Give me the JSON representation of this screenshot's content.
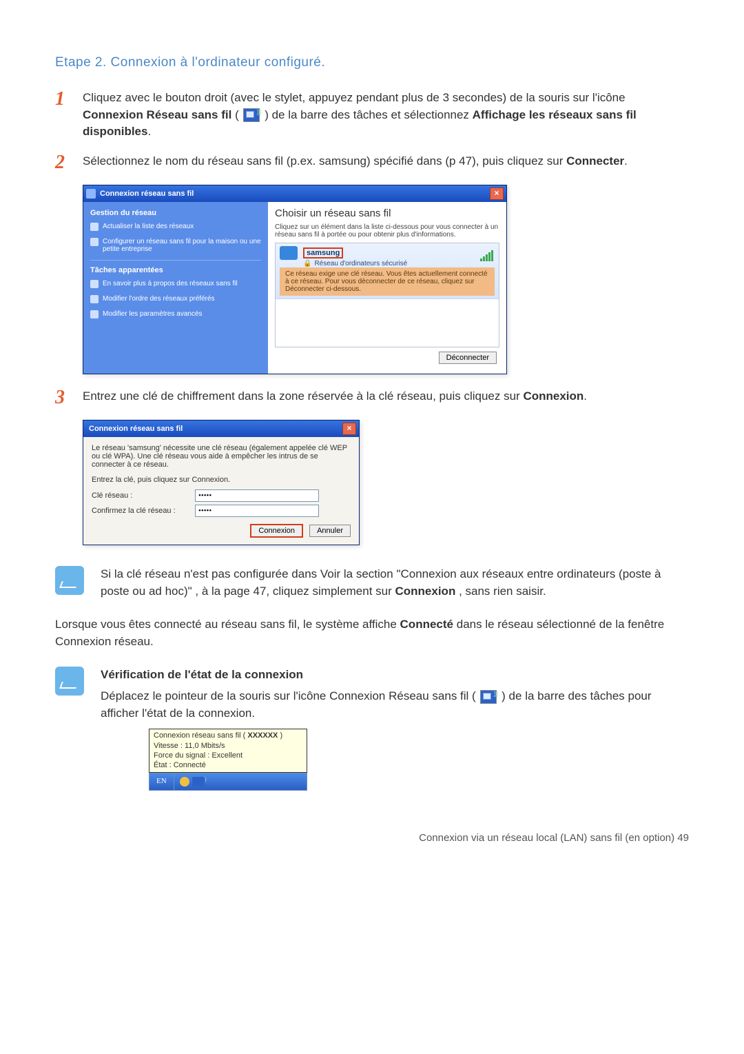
{
  "section_title": "Etape 2. Connexion à l'ordinateur configuré.",
  "step1": {
    "pre": "Cliquez avec le bouton droit (avec le stylet, appuyez pendant plus de 3 secondes) de la souris sur l'icône ",
    "bold_icon_label": "Connexion Réseau sans fil",
    "mid": " ( ",
    "mid2": " ) de la barre des tâches et sélectionnez ",
    "bold_action": "Affichage les réseaux sans fil disponibles",
    "end": "."
  },
  "step2": {
    "text_a": "Sélectionnez le nom du réseau sans fil (p.ex. samsung) spécifié dans    (p 47), puis cliquez sur ",
    "bold": "Connecter",
    "end": "."
  },
  "dlg1": {
    "title": "Connexion réseau sans fil",
    "left": {
      "head1": "Gestion du réseau",
      "link1": "Actualiser la liste des réseaux",
      "link2": "Configurer un réseau sans fil pour la maison ou une petite entreprise",
      "head2": "Tâches apparentées",
      "link3": "En savoir plus à propos des réseaux sans fil",
      "link4": "Modifier l'ordre des réseaux préférés",
      "link5": "Modifier les paramètres avancés"
    },
    "right": {
      "head": "Choisir un réseau sans fil",
      "sub": "Cliquez sur un élément dans la liste ci-dessous pour vous connecter à un réseau sans fil à portée ou pour obtenir plus d'informations.",
      "net_name": "samsung",
      "net_type": "Réseau d'ordinateurs sécurisé",
      "net_msg": "Ce réseau exige une clé réseau. Vous êtes actuellement connecté à ce réseau. Pour vous déconnecter de ce réseau, cliquez sur Déconnecter ci-dessous.",
      "disconnect": "Déconnecter"
    }
  },
  "step3": {
    "text": "Entrez une clé de chiffrement dans la zone réservée à la clé réseau, puis cliquez sur ",
    "bold": "Connexion",
    "end": "."
  },
  "dlg2": {
    "title": "Connexion réseau sans fil",
    "desc": "Le réseau 'samsung' nécessite une clé réseau (également appelée clé WEP ou clé WPA). Une clé réseau vous aide à empêcher les intrus de se connecter à ce réseau.",
    "instr": "Entrez la clé, puis cliquez sur Connexion.",
    "label_key": "Clé réseau :",
    "label_confirm": "Confirmez la clé réseau :",
    "key_value": "•••••",
    "btn_connect": "Connexion",
    "btn_cancel": "Annuler"
  },
  "note1": "Si la clé réseau n'est pas configurée dans Voir la section \"Connexion aux réseaux entre ordinateurs (poste à poste ou ad hoc)\" , à la page 47, cliquez simplement sur ",
  "note1_bold": "Connexion",
  "note1_end": ", sans rien saisir.",
  "para_connected_a": "Lorsque vous êtes connecté au réseau sans fil, le système affiche ",
  "para_connected_bold": "Connecté",
  "para_connected_b": " dans le réseau sélectionné de la fenêtre Connexion réseau.",
  "check": {
    "title": "Vérification de l'état de la connexion",
    "text_a": "Déplacez le pointeur de la souris sur l'icône Connexion Réseau sans fil ( ",
    "text_b": " ) de la barre des tâches pour afficher l'état de la connexion."
  },
  "tooltip": {
    "l1a": "Connexion réseau sans fil (  ",
    "l1b_bold": "XXXXXX",
    "l1c": "  )",
    "l2": "Vitesse : 11,0 Mbits/s",
    "l3": "Force du signal : Excellent",
    "l4": "État : Connecté"
  },
  "taskbar_lang": "EN",
  "footer": "Connexion via un réseau local (LAN) sans fil (en option)   49"
}
